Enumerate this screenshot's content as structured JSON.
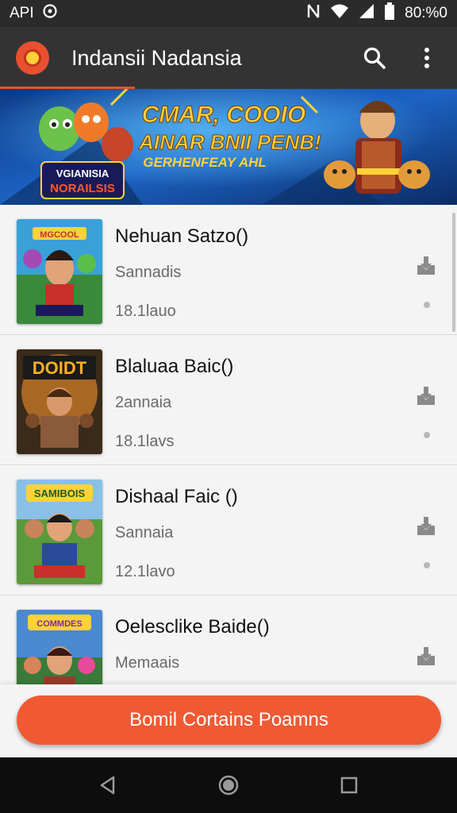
{
  "status_bar": {
    "left_text": "API",
    "right_text": "80:%0",
    "icons": [
      "target-icon",
      "nfc-icon",
      "wifi-icon",
      "signal-icon",
      "battery-icon"
    ]
  },
  "app_bar": {
    "title": "Indansii Nadansia",
    "icons": [
      "app-logo",
      "search-icon",
      "more-vert-icon"
    ]
  },
  "banner": {
    "headline_1": "CMAR, COOIO",
    "headline_2": "AINAR BNII PENB!",
    "headline_3": "GERHENFEAY AHL",
    "badge_1": "VGIANISIA",
    "badge_2": "NORAILSIS"
  },
  "items": [
    {
      "title": "Nehuan Satzo()",
      "subtitle": "Sannadis",
      "meta": "18.1lauo",
      "art_label": "MGCOOL",
      "icon": "download-icon"
    },
    {
      "title": "Blaluaa Baic()",
      "subtitle": "2annaia",
      "meta": "18.1lavs",
      "art_label": "DOIDT",
      "icon": "download-icon"
    },
    {
      "title": "Dishaal Faic ()",
      "subtitle": "Sannaia",
      "meta": "12.1lavo",
      "art_label": "SAMIBOIS",
      "icon": "download-icon"
    },
    {
      "title": "Oelesclike Baide()",
      "subtitle": "Memaais",
      "meta": "",
      "art_label": "COMMDES",
      "icon": "download-icon"
    }
  ],
  "cta": {
    "label": "Bomil Cortains Poamns"
  },
  "nav": {
    "icons": [
      "back-icon",
      "home-icon",
      "recents-icon"
    ]
  },
  "colors": {
    "accent": "#ef5a33",
    "app_bar": "#333333",
    "status_bar": "#2b2b2b"
  }
}
